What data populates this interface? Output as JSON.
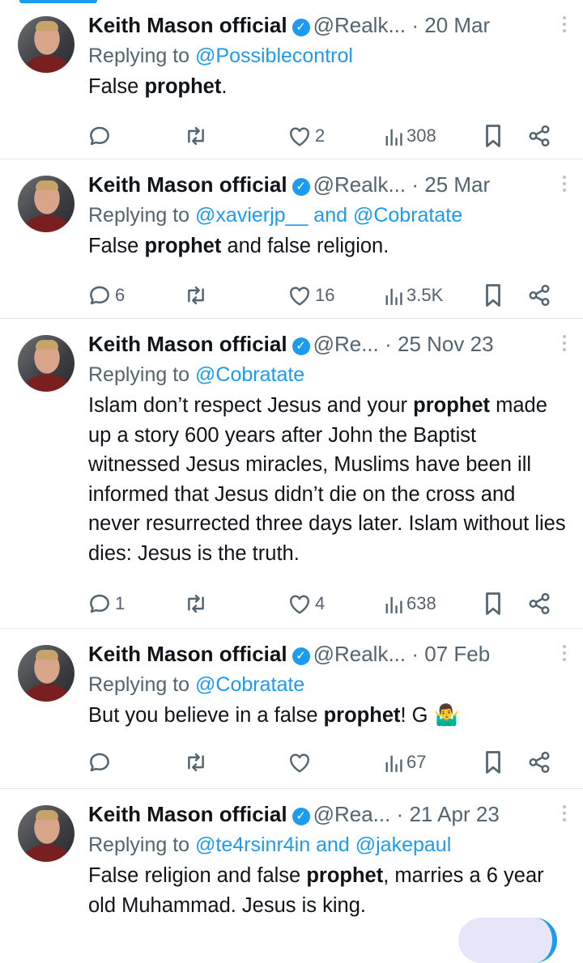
{
  "tweets": [
    {
      "name": "Keith Mason official",
      "handle": "@Realk...",
      "date": "· 20 Mar",
      "reply_prefix": "Replying to ",
      "reply_mentions": "@Possiblecontrol",
      "text": [
        {
          "t": "False "
        },
        {
          "t": "prophet",
          "b": true
        },
        {
          "t": "."
        }
      ],
      "replies": "",
      "retweets": "",
      "likes": "2",
      "views": "308"
    },
    {
      "name": "Keith Mason official",
      "handle": "@Realk...",
      "date": "· 25 Mar",
      "reply_prefix": "Replying to ",
      "reply_mentions": "@xavierjp__ and @Cobratate",
      "text": [
        {
          "t": "False "
        },
        {
          "t": "prophet",
          "b": true
        },
        {
          "t": " and false religion."
        }
      ],
      "replies": "6",
      "retweets": "",
      "likes": "16",
      "views": "3.5K"
    },
    {
      "name": "Keith Mason official",
      "handle": "@Re...",
      "date": "· 25 Nov 23",
      "reply_prefix": "Replying to ",
      "reply_mentions": "@Cobratate",
      "text": [
        {
          "t": "Islam don’t respect Jesus and your "
        },
        {
          "t": "prophet",
          "b": true
        },
        {
          "t": " made up a story 600 years after John the Baptist witnessed Jesus miracles, Muslims have been ill informed that Jesus didn’t die on the cross and never resurrected three days later. Islam without lies dies: Jesus is the truth."
        }
      ],
      "replies": "1",
      "retweets": "",
      "likes": "4",
      "views": "638"
    },
    {
      "name": "Keith Mason official",
      "handle": "@Realk...",
      "date": "· 07 Feb",
      "reply_prefix": "Replying to ",
      "reply_mentions": "@Cobratate",
      "text": [
        {
          "t": "But you believe in a false "
        },
        {
          "t": "prophet",
          "b": true
        },
        {
          "t": "! G 🤷‍♂️"
        }
      ],
      "replies": "",
      "retweets": "",
      "likes": "",
      "views": "67"
    },
    {
      "name": "Keith Mason official",
      "handle": "@Rea...",
      "date": "· 21 Apr 23",
      "reply_prefix": "Replying to ",
      "reply_mentions": "@te4rsinr4in and @jakepaul",
      "text": [
        {
          "t": "False religion and false "
        },
        {
          "t": "prophet",
          "b": true
        },
        {
          "t": ", marries a 6 year old Muhammad. Jesus is king."
        }
      ],
      "replies": "",
      "retweets": "",
      "likes": "",
      "views": ""
    }
  ],
  "icons": {
    "verified": "verified-badge-icon",
    "reply": "reply-icon",
    "retweet": "retweet-icon",
    "like": "heart-icon",
    "views": "views-icon",
    "bookmark": "bookmark-icon",
    "share": "share-icon",
    "more": "more-icon"
  },
  "colors": {
    "accent": "#1d9bf0",
    "secondary_text": "#536471",
    "text": "#0f1419"
  }
}
